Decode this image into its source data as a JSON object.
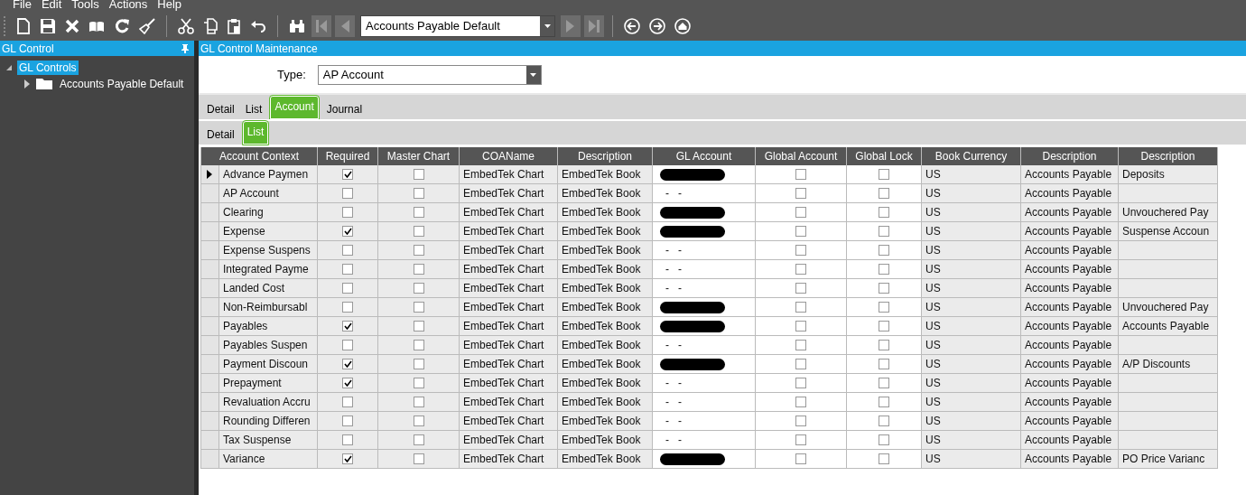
{
  "menu": [
    "File",
    "Edit",
    "Tools",
    "Actions",
    "Help"
  ],
  "toolbar": {
    "record": "Accounts Payable Default"
  },
  "left_panel": {
    "title": "GL Control",
    "tree": [
      {
        "label": "GL Controls",
        "selected": true,
        "expanded": true,
        "children": [
          {
            "label": "Accounts Payable Default",
            "selected": false,
            "expanded": false
          }
        ]
      }
    ]
  },
  "main": {
    "title": "GL Control Maintenance",
    "type_label": "Type:",
    "type_value": "AP Account",
    "tabs": [
      {
        "label": "Detail",
        "selected": false
      },
      {
        "label": "List",
        "selected": false
      },
      {
        "label": "Account",
        "selected": true
      },
      {
        "label": "Journal",
        "selected": false
      }
    ],
    "subtabs": [
      {
        "label": "Detail",
        "selected": false
      },
      {
        "label": "List",
        "selected": true
      }
    ],
    "table": {
      "columns": [
        "Account Context",
        "Required",
        "Master Chart",
        "COAName",
        "Description",
        "GL Account",
        "Global Account",
        "Global Lock",
        "Book Currency",
        "Description",
        "Description"
      ],
      "rows": [
        {
          "current": true,
          "account_context": "Advance Paymen",
          "required": true,
          "master_chart": false,
          "coa_name": "EmbedTek Chart",
          "description": "EmbedTek Book",
          "gl_account": {
            "kind": "redacted"
          },
          "global_account": false,
          "global_lock": false,
          "book_currency": "US",
          "description_2": "Accounts Payable",
          "description_3": "Deposits"
        },
        {
          "current": false,
          "account_context": "AP Account",
          "required": false,
          "master_chart": false,
          "coa_name": "EmbedTek Chart",
          "description": "EmbedTek Book",
          "gl_account": {
            "kind": "text",
            "text": "-   -"
          },
          "global_account": false,
          "global_lock": false,
          "book_currency": "US",
          "description_2": "Accounts Payable"
        },
        {
          "current": false,
          "account_context": "Clearing",
          "required": false,
          "master_chart": false,
          "coa_name": "EmbedTek Chart",
          "description": "EmbedTek Book",
          "gl_account": {
            "kind": "redacted"
          },
          "global_account": false,
          "global_lock": false,
          "book_currency": "US",
          "description_2": "Accounts Payable",
          "description_3": "Unvouchered Pay"
        },
        {
          "current": false,
          "account_context": "Expense",
          "required": true,
          "master_chart": false,
          "coa_name": "EmbedTek Chart",
          "description": "EmbedTek Book",
          "gl_account": {
            "kind": "redacted"
          },
          "global_account": false,
          "global_lock": false,
          "book_currency": "US",
          "description_2": "Accounts Payable",
          "description_3": "Suspense Accoun"
        },
        {
          "current": false,
          "account_context": "Expense Suspens",
          "required": false,
          "master_chart": false,
          "coa_name": "EmbedTek Chart",
          "description": "EmbedTek Book",
          "gl_account": {
            "kind": "text",
            "text": "-   -"
          },
          "global_account": false,
          "global_lock": false,
          "book_currency": "US",
          "description_2": "Accounts Payable"
        },
        {
          "current": false,
          "account_context": "Integrated Payme",
          "required": false,
          "master_chart": false,
          "coa_name": "EmbedTek Chart",
          "description": "EmbedTek Book",
          "gl_account": {
            "kind": "text",
            "text": "-   -"
          },
          "global_account": false,
          "global_lock": false,
          "book_currency": "US",
          "description_2": "Accounts Payable"
        },
        {
          "current": false,
          "account_context": "Landed Cost",
          "required": false,
          "master_chart": false,
          "coa_name": "EmbedTek Chart",
          "description": "EmbedTek Book",
          "gl_account": {
            "kind": "text",
            "text": "-   -"
          },
          "global_account": false,
          "global_lock": false,
          "book_currency": "US",
          "description_2": "Accounts Payable"
        },
        {
          "current": false,
          "account_context": "Non-Reimbursabl",
          "required": false,
          "master_chart": false,
          "coa_name": "EmbedTek Chart",
          "description": "EmbedTek Book",
          "gl_account": {
            "kind": "redacted"
          },
          "global_account": false,
          "global_lock": false,
          "book_currency": "US",
          "description_2": "Accounts Payable",
          "description_3": "Unvouchered Pay"
        },
        {
          "current": false,
          "account_context": "Payables",
          "required": true,
          "master_chart": false,
          "coa_name": "EmbedTek Chart",
          "description": "EmbedTek Book",
          "gl_account": {
            "kind": "redacted"
          },
          "global_account": false,
          "global_lock": false,
          "book_currency": "US",
          "description_2": "Accounts Payable",
          "description_3": "Accounts Payable"
        },
        {
          "current": false,
          "account_context": "Payables Suspen",
          "required": false,
          "master_chart": false,
          "coa_name": "EmbedTek Chart",
          "description": "EmbedTek Book",
          "gl_account": {
            "kind": "text",
            "text": "-   -"
          },
          "global_account": false,
          "global_lock": false,
          "book_currency": "US",
          "description_2": "Accounts Payable"
        },
        {
          "current": false,
          "account_context": "Payment Discoun",
          "required": true,
          "master_chart": false,
          "coa_name": "EmbedTek Chart",
          "description": "EmbedTek Book",
          "gl_account": {
            "kind": "redacted"
          },
          "global_account": false,
          "global_lock": false,
          "book_currency": "US",
          "description_2": "Accounts Payable",
          "description_3": "A/P Discounts"
        },
        {
          "current": false,
          "account_context": "Prepayment",
          "required": true,
          "master_chart": false,
          "coa_name": "EmbedTek Chart",
          "description": "EmbedTek Book",
          "gl_account": {
            "kind": "text",
            "text": "-   -"
          },
          "global_account": false,
          "global_lock": false,
          "book_currency": "US",
          "description_2": "Accounts Payable"
        },
        {
          "current": false,
          "account_context": "Revaluation Accru",
          "required": false,
          "master_chart": false,
          "coa_name": "EmbedTek Chart",
          "description": "EmbedTek Book",
          "gl_account": {
            "kind": "text",
            "text": "-   -"
          },
          "global_account": false,
          "global_lock": false,
          "book_currency": "US",
          "description_2": "Accounts Payable"
        },
        {
          "current": false,
          "account_context": "Rounding Differen",
          "required": false,
          "master_chart": false,
          "coa_name": "EmbedTek Chart",
          "description": "EmbedTek Book",
          "gl_account": {
            "kind": "text",
            "text": "-   -"
          },
          "global_account": false,
          "global_lock": false,
          "book_currency": "US",
          "description_2": "Accounts Payable"
        },
        {
          "current": false,
          "account_context": "Tax Suspense",
          "required": false,
          "master_chart": false,
          "coa_name": "EmbedTek Chart",
          "description": "EmbedTek Book",
          "gl_account": {
            "kind": "text",
            "text": "-   -"
          },
          "global_account": false,
          "global_lock": false,
          "book_currency": "US",
          "description_2": "Accounts Payable"
        },
        {
          "current": false,
          "account_context": "Variance",
          "required": true,
          "master_chart": false,
          "coa_name": "EmbedTek Chart",
          "description": "EmbedTek Book",
          "gl_account": {
            "kind": "redacted"
          },
          "global_account": false,
          "global_lock": false,
          "book_currency": "US",
          "description_2": "Accounts Payable",
          "description_3": "PO Price Varianc"
        }
      ]
    }
  }
}
